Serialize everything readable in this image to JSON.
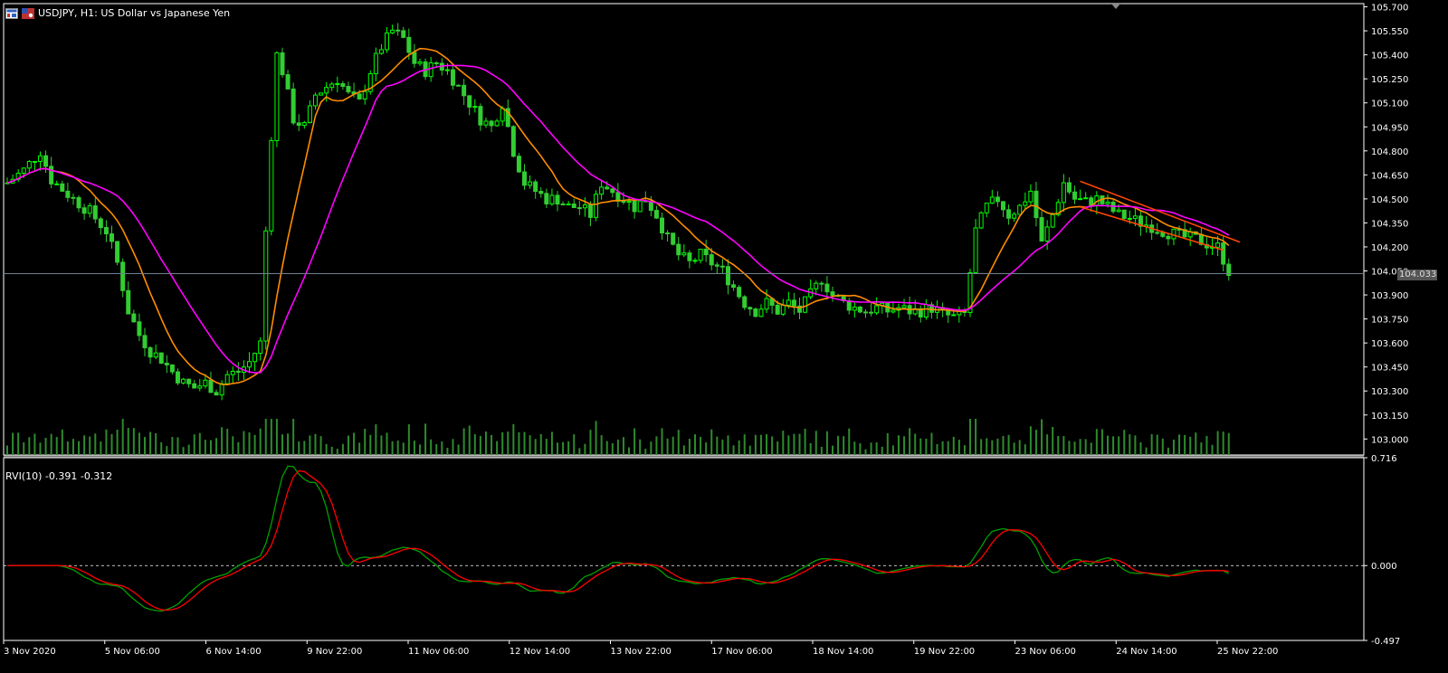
{
  "header": {
    "symbol_title": "USDJPY, H1:  US Dollar vs Japanese Yen"
  },
  "indicator": {
    "label": "RVI(10) -0.391 -0.312"
  },
  "price": {
    "current": "104.033",
    "current_value": 104.033
  },
  "colors": {
    "background": "#000000",
    "candle_bull": "#00ff00",
    "candle_bear": "#32cd32",
    "ma_fast": "#ff8c00",
    "ma_slow": "#ff00ff",
    "trendline": "#ff4500",
    "volume": "#2e8b2e",
    "rvi_main": "#00a000",
    "rvi_signal": "#ff0000",
    "axis": "#ffffff",
    "price_line": "#708090"
  },
  "chart_data": [
    {
      "type": "candlestick",
      "symbol": "USDJPY",
      "timeframe": "H1",
      "ylim": [
        102.9,
        105.72
      ],
      "yticks": [
        103.0,
        103.15,
        103.3,
        103.45,
        103.6,
        103.75,
        103.9,
        104.05,
        104.2,
        104.35,
        104.5,
        104.65,
        104.8,
        104.95,
        105.1,
        105.25,
        105.4,
        105.55,
        105.7
      ],
      "xtick_labels": [
        "3 Nov 2020",
        "5 Nov 06:00",
        "6 Nov 14:00",
        "9 Nov 22:00",
        "11 Nov 06:00",
        "12 Nov 14:00",
        "13 Nov 22:00",
        "17 Nov 06:00",
        "18 Nov 14:00",
        "19 Nov 22:00",
        "23 Nov 06:00",
        "24 Nov 14:00",
        "25 Nov 22:00"
      ],
      "price_path": [
        [
          0,
          104.6
        ],
        [
          3,
          104.68
        ],
        [
          6,
          104.8
        ],
        [
          8,
          104.62
        ],
        [
          12,
          104.5
        ],
        [
          15,
          104.42
        ],
        [
          18,
          104.3
        ],
        [
          20,
          104.1
        ],
        [
          22,
          103.8
        ],
        [
          24,
          103.65
        ],
        [
          26,
          103.55
        ],
        [
          28,
          103.5
        ],
        [
          30,
          103.42
        ],
        [
          32,
          103.35
        ],
        [
          34,
          103.32
        ],
        [
          36,
          103.35
        ],
        [
          38,
          103.3
        ],
        [
          40,
          103.4
        ],
        [
          42,
          103.42
        ],
        [
          44,
          103.48
        ],
        [
          46,
          103.6
        ],
        [
          47,
          104.3
        ],
        [
          48,
          104.9
        ],
        [
          49,
          105.4
        ],
        [
          50,
          105.3
        ],
        [
          52,
          105.0
        ],
        [
          54,
          104.95
        ],
        [
          56,
          105.15
        ],
        [
          58,
          105.2
        ],
        [
          60,
          105.25
        ],
        [
          62,
          105.15
        ],
        [
          64,
          105.1
        ],
        [
          66,
          105.3
        ],
        [
          68,
          105.45
        ],
        [
          70,
          105.55
        ],
        [
          72,
          105.5
        ],
        [
          74,
          105.35
        ],
        [
          76,
          105.3
        ],
        [
          78,
          105.35
        ],
        [
          80,
          105.3
        ],
        [
          82,
          105.2
        ],
        [
          84,
          105.1
        ],
        [
          86,
          105.0
        ],
        [
          88,
          104.95
        ],
        [
          90,
          105.1
        ],
        [
          92,
          104.8
        ],
        [
          94,
          104.6
        ],
        [
          96,
          104.55
        ],
        [
          98,
          104.5
        ],
        [
          100,
          104.5
        ],
        [
          102,
          104.45
        ],
        [
          104,
          104.45
        ],
        [
          106,
          104.4
        ],
        [
          108,
          104.6
        ],
        [
          110,
          104.55
        ],
        [
          112,
          104.5
        ],
        [
          114,
          104.45
        ],
        [
          116,
          104.5
        ],
        [
          118,
          104.4
        ],
        [
          120,
          104.25
        ],
        [
          122,
          104.15
        ],
        [
          124,
          104.1
        ],
        [
          126,
          104.15
        ],
        [
          128,
          104.1
        ],
        [
          130,
          104.05
        ],
        [
          132,
          103.95
        ],
        [
          134,
          103.85
        ],
        [
          136,
          103.8
        ],
        [
          138,
          103.85
        ],
        [
          140,
          103.8
        ],
        [
          142,
          103.85
        ],
        [
          144,
          103.8
        ],
        [
          146,
          103.9
        ],
        [
          148,
          104.0
        ],
        [
          150,
          103.9
        ],
        [
          152,
          103.85
        ],
        [
          154,
          103.82
        ],
        [
          156,
          103.8
        ],
        [
          158,
          103.82
        ],
        [
          160,
          103.8
        ],
        [
          162,
          103.82
        ],
        [
          164,
          103.8
        ],
        [
          166,
          103.8
        ],
        [
          168,
          103.82
        ],
        [
          170,
          103.78
        ],
        [
          172,
          103.76
        ],
        [
          174,
          103.78
        ],
        [
          176,
          104.3
        ],
        [
          178,
          104.45
        ],
        [
          180,
          104.5
        ],
        [
          182,
          104.4
        ],
        [
          184,
          104.45
        ],
        [
          186,
          104.55
        ],
        [
          188,
          104.22
        ],
        [
          190,
          104.4
        ],
        [
          192,
          104.6
        ],
        [
          194,
          104.5
        ],
        [
          196,
          104.48
        ],
        [
          198,
          104.5
        ],
        [
          200,
          104.45
        ],
        [
          202,
          104.4
        ],
        [
          204,
          104.38
        ],
        [
          206,
          104.35
        ],
        [
          208,
          104.33
        ],
        [
          210,
          104.3
        ],
        [
          212,
          104.28
        ],
        [
          214,
          104.26
        ],
        [
          216,
          104.25
        ],
        [
          218,
          104.22
        ],
        [
          220,
          104.2
        ],
        [
          222,
          104.05
        ]
      ],
      "n_candles": 223,
      "moving_averages": [
        {
          "period": 10,
          "kind": "ma",
          "color": "#ff8c00"
        },
        {
          "period": 21,
          "kind": "ma",
          "color": "#ff00ff"
        }
      ],
      "trendlines": [
        {
          "from": [
            195,
            104.61
          ],
          "to": [
            224,
            104.23
          ]
        },
        {
          "from": [
            195,
            104.45
          ],
          "to": [
            221,
            104.18
          ]
        }
      ],
      "current_price": 104.033
    },
    {
      "type": "line",
      "name": "RVI(10)",
      "ylim": [
        -0.497,
        0.716
      ],
      "yticks": [
        0.716,
        0.0,
        -0.497
      ],
      "zero_line": true,
      "last_values": [
        -0.391,
        -0.312
      ],
      "series": [
        {
          "name": "RVI",
          "color": "#00a000"
        },
        {
          "name": "Signal",
          "color": "#ff0000"
        }
      ]
    }
  ]
}
